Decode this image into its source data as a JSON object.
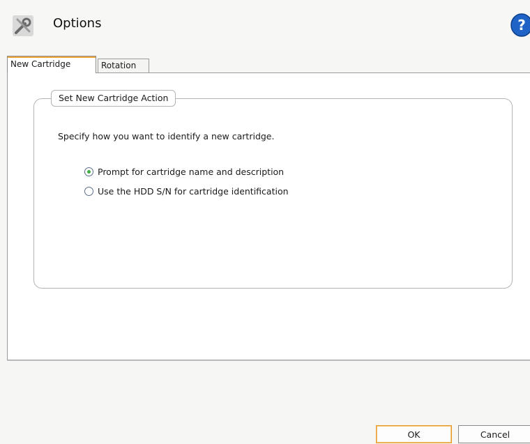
{
  "header": {
    "title": "Options",
    "icon": "tools-icon",
    "help_icon": "help-icon"
  },
  "tabs": [
    {
      "label": "New Cartridge",
      "active": true
    },
    {
      "label": "Rotation",
      "active": false
    }
  ],
  "group": {
    "legend": "Set New Cartridge Action",
    "description": "Specify how you want to identify a new cartridge.",
    "options": [
      {
        "label": "Prompt for cartridge name and description",
        "selected": true
      },
      {
        "label": "Use the HDD S/N for cartridge identification",
        "selected": false
      }
    ]
  },
  "buttons": {
    "ok": "OK",
    "cancel": "Cancel"
  },
  "colors": {
    "accent_orange": "#f0a43a",
    "radio_selected": "#3fae3f",
    "help_blue": "#1f63c6"
  }
}
